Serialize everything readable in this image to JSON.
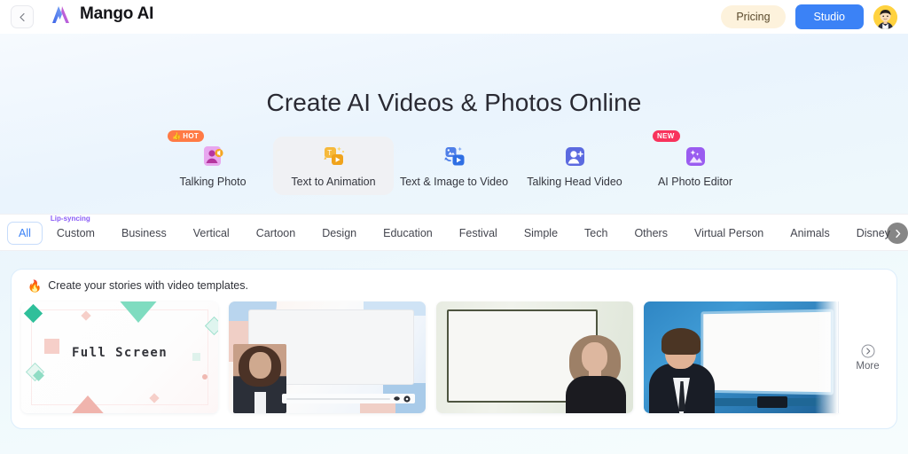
{
  "header": {
    "back_icon": "chevron-left-icon",
    "logo_icon": "mango-ai-logo",
    "brand_name": "Mango AI",
    "pricing_label": "Pricing",
    "studio_label": "Studio",
    "avatar_icon": "user-avatar"
  },
  "hero": {
    "headline": "Create AI Videos & Photos Online"
  },
  "features": [
    {
      "label": "Talking Photo",
      "icon": "talking-photo-icon",
      "badge": "HOT",
      "badge_type": "hot",
      "active": false
    },
    {
      "label": "Text to Animation",
      "icon": "text-to-animation-icon",
      "badge": "",
      "badge_type": "",
      "active": true
    },
    {
      "label": "Text & Image to Video",
      "icon": "text-image-to-video-icon",
      "badge": "",
      "badge_type": "",
      "active": false
    },
    {
      "label": "Talking Head Video",
      "icon": "talking-head-video-icon",
      "badge": "",
      "badge_type": "",
      "active": false
    },
    {
      "label": "AI Photo Editor",
      "icon": "ai-photo-editor-icon",
      "badge": "NEW",
      "badge_type": "new",
      "active": false
    }
  ],
  "tabs": [
    {
      "label": "All",
      "active": true,
      "badge": ""
    },
    {
      "label": "Custom",
      "active": false,
      "badge": "Lip-syncing"
    },
    {
      "label": "Business",
      "active": false,
      "badge": ""
    },
    {
      "label": "Vertical",
      "active": false,
      "badge": ""
    },
    {
      "label": "Cartoon",
      "active": false,
      "badge": ""
    },
    {
      "label": "Design",
      "active": false,
      "badge": ""
    },
    {
      "label": "Education",
      "active": false,
      "badge": ""
    },
    {
      "label": "Festival",
      "active": false,
      "badge": ""
    },
    {
      "label": "Simple",
      "active": false,
      "badge": ""
    },
    {
      "label": "Tech",
      "active": false,
      "badge": ""
    },
    {
      "label": "Others",
      "active": false,
      "badge": ""
    },
    {
      "label": "Virtual Person",
      "active": false,
      "badge": ""
    },
    {
      "label": "Animals",
      "active": false,
      "badge": ""
    },
    {
      "label": "Disney",
      "active": false,
      "badge": ""
    }
  ],
  "tabs_scroll_icon": "chevron-right-icon",
  "templates": {
    "heading_emoji": "fire-emoji",
    "heading": "Create your stories with video templates.",
    "cards": [
      {
        "name": "full-screen-geometric",
        "caption": "Full Screen"
      },
      {
        "name": "business-woman-screen-share",
        "caption": ""
      },
      {
        "name": "whiteboard-presenter-woman",
        "caption": ""
      },
      {
        "name": "blue-studio-presenter-man",
        "caption": ""
      }
    ],
    "more_label": "More",
    "more_icon": "chevron-right-circle-icon"
  },
  "colors": {
    "accent_blue": "#3b82f6",
    "pricing_bg": "#fdf2dc",
    "hot_badge": "#ff7a45",
    "new_badge": "#f8335c",
    "lip_sync_badge": "#8a5cf6",
    "page_bg": "#eaf4fd"
  }
}
